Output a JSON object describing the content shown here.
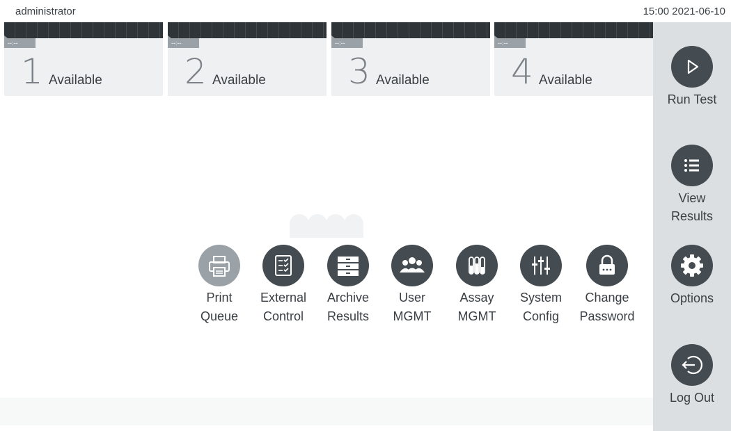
{
  "topbar": {
    "user": "administrator",
    "datetime": "15:00 2021-06-10"
  },
  "bays": [
    {
      "tag": "--:--",
      "number": "1",
      "status": "Available"
    },
    {
      "tag": "--:--",
      "number": "2",
      "status": "Available"
    },
    {
      "tag": "--:--",
      "number": "3",
      "status": "Available"
    },
    {
      "tag": "--:--",
      "number": "4",
      "status": "Available"
    }
  ],
  "sidebar": {
    "run_test": {
      "label": "Run Test",
      "icon": "play-icon"
    },
    "view_results": {
      "label_line1": "View",
      "label_line2": "Results",
      "icon": "list-icon"
    },
    "options": {
      "label": "Options",
      "icon": "gear-icon"
    },
    "log_out": {
      "label": "Log Out",
      "icon": "logout-icon"
    }
  },
  "tools": [
    {
      "line1": "Print",
      "line2": "Queue",
      "icon": "printer-icon",
      "enabled": false
    },
    {
      "line1": "External",
      "line2": "Control",
      "icon": "checklist-icon",
      "enabled": true
    },
    {
      "line1": "Archive",
      "line2": "Results",
      "icon": "archive-icon",
      "enabled": true
    },
    {
      "line1": "User",
      "line2": "MGMT",
      "icon": "users-icon",
      "enabled": true
    },
    {
      "line1": "Assay",
      "line2": "MGMT",
      "icon": "test-tubes-icon",
      "enabled": true
    },
    {
      "line1": "System",
      "line2": "Config",
      "icon": "sliders-icon",
      "enabled": true
    },
    {
      "line1": "Change",
      "line2": "Password",
      "icon": "lock-icon",
      "enabled": true
    }
  ],
  "colors": {
    "button_dark": "#444c52",
    "button_disabled": "#9aa2a8",
    "sidebar_bg": "#dcdfe1",
    "bay_bg": "#eef0f1"
  }
}
